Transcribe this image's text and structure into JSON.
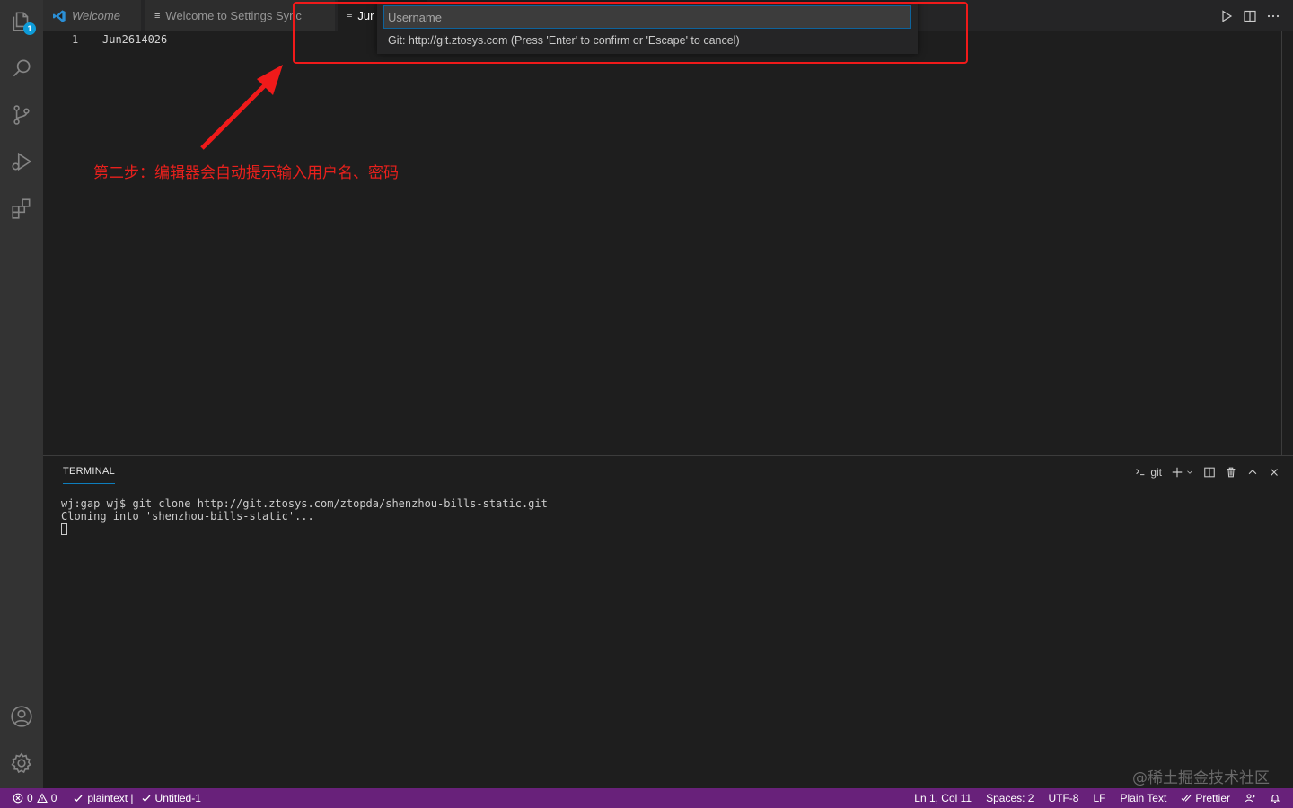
{
  "activity_bar": {
    "explorer_badge": "1"
  },
  "tabs": [
    {
      "label": "Welcome"
    },
    {
      "label": "Welcome to Settings Sync"
    },
    {
      "label": "Jur"
    }
  ],
  "editor": {
    "line_number": "1",
    "line_text": "Jun2614026"
  },
  "quick_input": {
    "placeholder": "Username",
    "message": "Git: http://git.ztosys.com (Press 'Enter' to confirm or 'Escape' to cancel)"
  },
  "annotation": {
    "text": "第二步：编辑器会自动提示输入用户名、密码"
  },
  "panel": {
    "tab_label": "TERMINAL",
    "shell_label": "git",
    "lines": [
      "wj:gap wj$ git clone http://git.ztosys.com/ztopda/shenzhou-bills-static.git",
      "Cloning into 'shenzhou-bills-static'..."
    ]
  },
  "watermark": "@稀土掘金技术社区",
  "status_bar": {
    "errors": "0",
    "warnings": "0",
    "language_check": "plaintext |",
    "file_check": "Untitled-1",
    "position": "Ln 1, Col 11",
    "spaces": "Spaces: 2",
    "encoding": "UTF-8",
    "eol": "LF",
    "mode": "Plain Text",
    "prettier": "Prettier"
  },
  "colors": {
    "status_bar": "#68217a",
    "accent": "#0e639c",
    "annotation": "#f01a1a"
  }
}
